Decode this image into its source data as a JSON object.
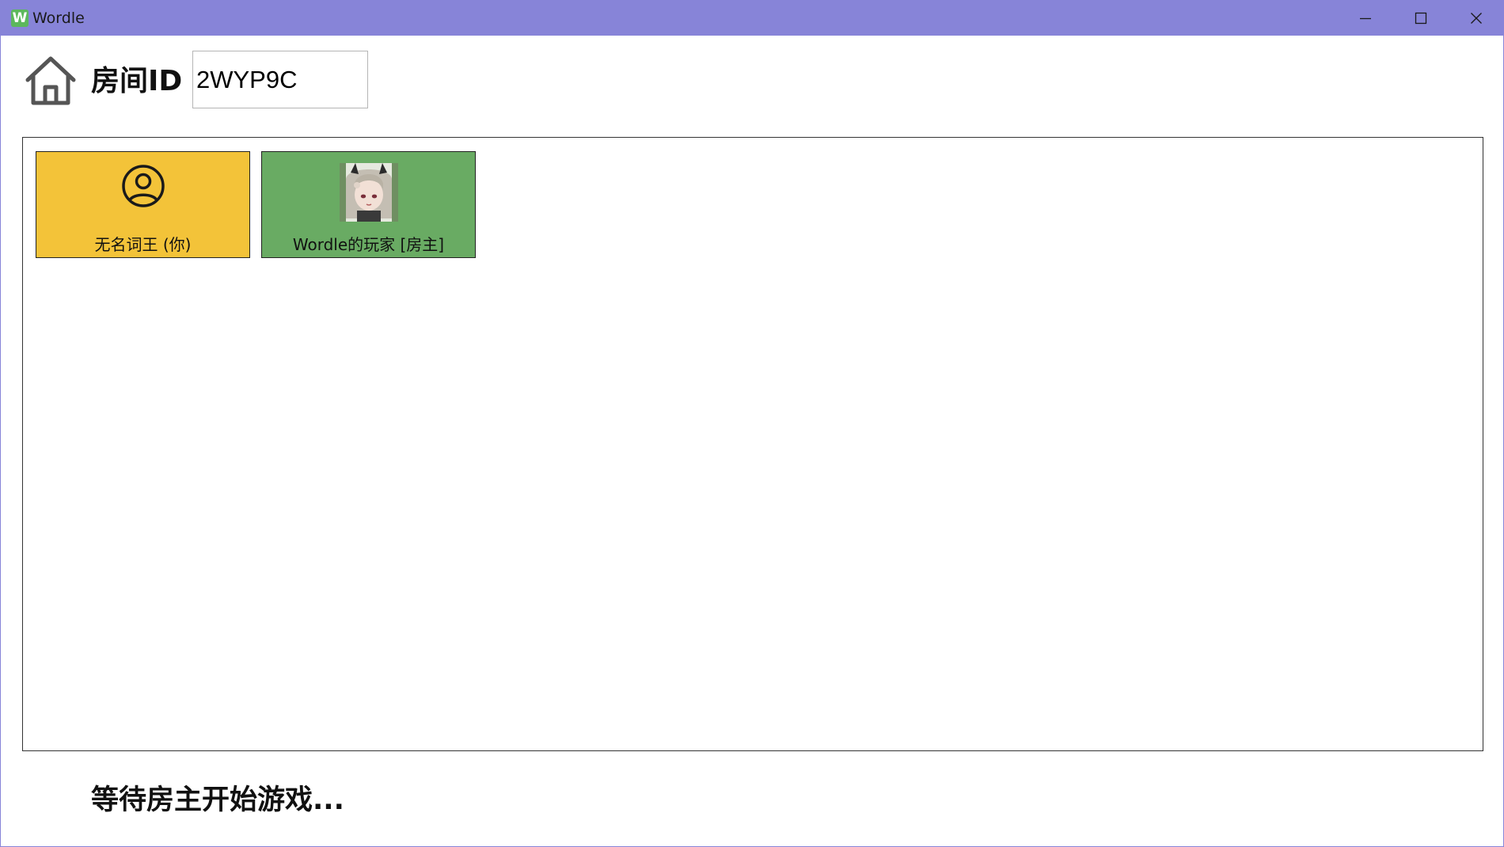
{
  "window": {
    "title": "Wordle",
    "app_icon_letter": "W",
    "titlebar_color": "#8784d8"
  },
  "header": {
    "home_icon": "home-icon",
    "room_id_label": "房间ID",
    "room_id_value": "2WYP9C"
  },
  "players": [
    {
      "name": "无名词王 (你)",
      "avatar": "user-circle-icon",
      "color": "#f3c339"
    },
    {
      "name": "Wordle的玩家 [房主]",
      "avatar": "profile-picture",
      "color": "#69ab63"
    }
  ],
  "status": "等待房主开始游戏..."
}
